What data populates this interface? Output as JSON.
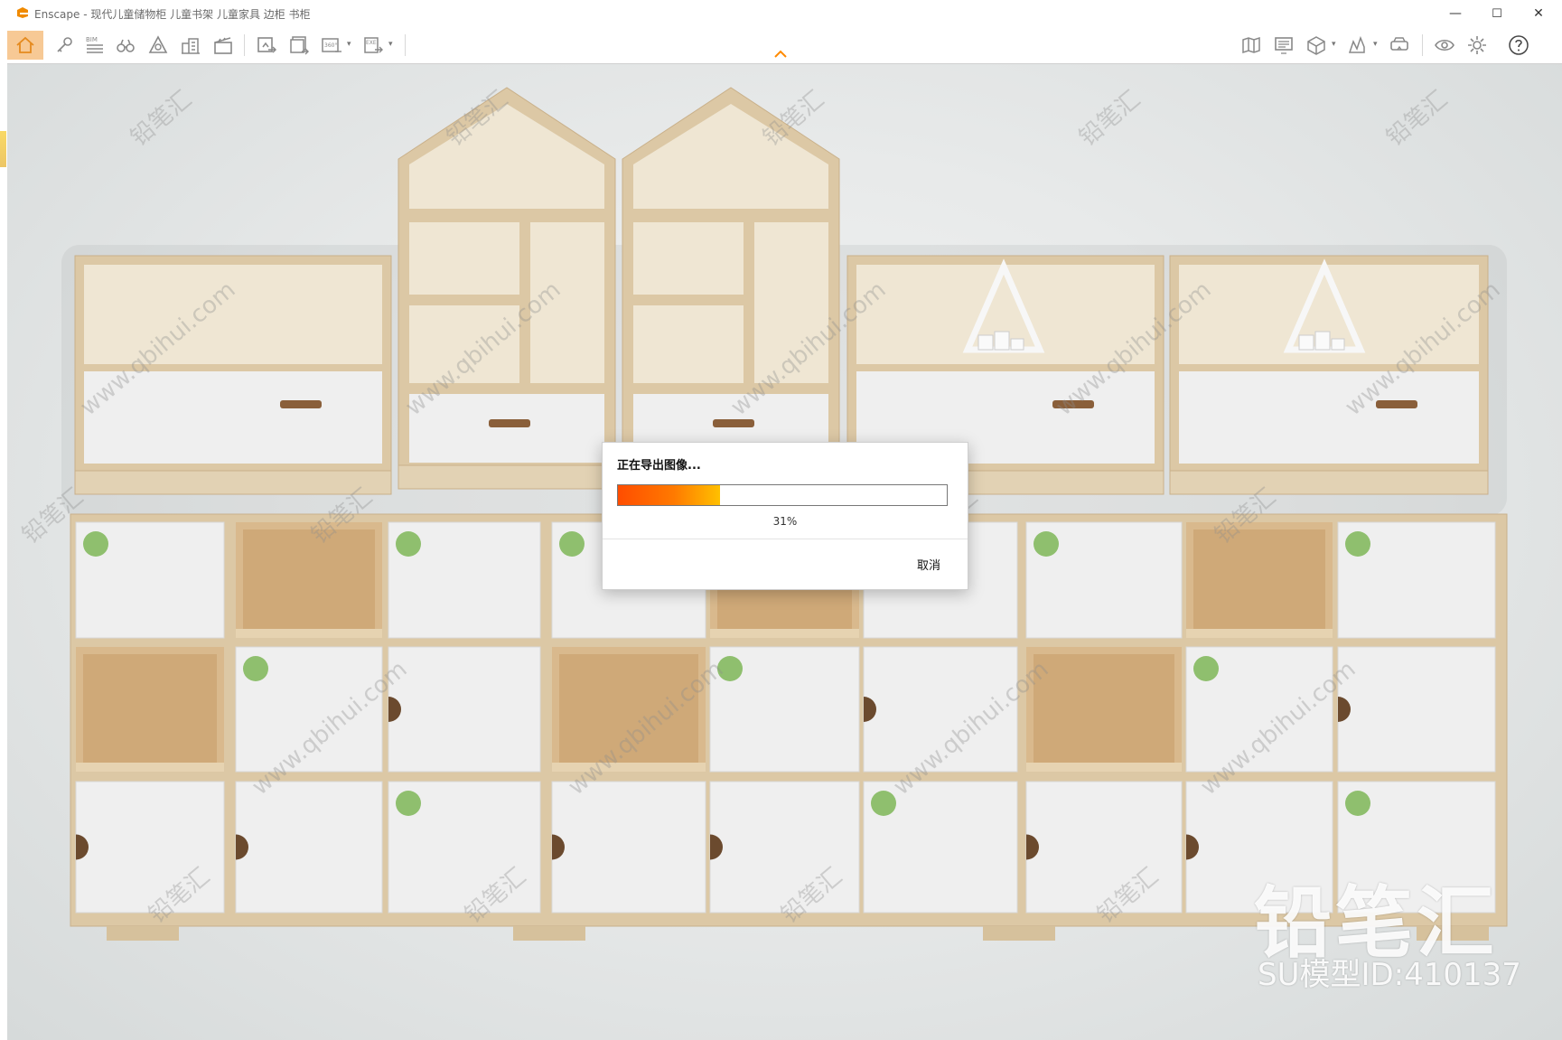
{
  "window": {
    "title": "Enscape - 现代儿童储物柜 儿童书架 儿童家具 边柜 书柜",
    "minimize_label": "—",
    "maximize_label": "☐",
    "close_label": "✕"
  },
  "toolbar": {
    "bim_label": "BIM",
    "panorama_label": "360°",
    "exe_label": "EXE"
  },
  "icons": {
    "home": "home-icon",
    "link": "link-icon",
    "bim": "bim-list-icon",
    "binoculars": "binoculars-icon",
    "asset": "asset-library-icon",
    "buildings": "buildings-icon",
    "video": "video-editor-icon",
    "screenshot": "export-screenshot-icon",
    "batch": "batch-render-icon",
    "panorama": "panorama-icon",
    "exe": "export-exe-icon",
    "map": "map-icon",
    "monitor": "monitor-icon",
    "cube": "cube-icon",
    "chart": "chart-icon",
    "vr": "vr-headset-icon",
    "eye": "eye-icon",
    "settings": "gear-icon",
    "help": "help-icon"
  },
  "colors": {
    "accent": "#ff8a00",
    "progress_start": "#ff4d00",
    "progress_end": "#ffc000",
    "wood": "#dcc8a5",
    "door": "#efefef",
    "knob": "#8fbf6e"
  },
  "export_dialog": {
    "title": "正在导出图像...",
    "progress": 0.31,
    "progress_text": "31%",
    "cancel_label": "取消"
  },
  "branding": {
    "name": "铅笔汇",
    "model_id": "SU模型ID:410137"
  },
  "watermark": {
    "text_cn": "铅笔汇",
    "text_url": "www.qbihui.com"
  }
}
